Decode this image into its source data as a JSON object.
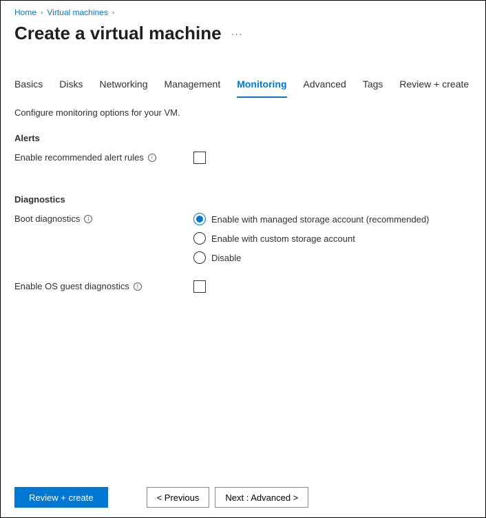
{
  "breadcrumb": {
    "items": [
      "Home",
      "Virtual machines"
    ]
  },
  "pageTitle": "Create a virtual machine",
  "tabs": [
    {
      "label": "Basics",
      "active": false
    },
    {
      "label": "Disks",
      "active": false
    },
    {
      "label": "Networking",
      "active": false
    },
    {
      "label": "Management",
      "active": false
    },
    {
      "label": "Monitoring",
      "active": true
    },
    {
      "label": "Advanced",
      "active": false
    },
    {
      "label": "Tags",
      "active": false
    },
    {
      "label": "Review + create",
      "active": false
    }
  ],
  "description": "Configure monitoring options for your VM.",
  "sections": {
    "alerts": {
      "heading": "Alerts",
      "field": {
        "label": "Enable recommended alert rules",
        "checked": false
      }
    },
    "diagnostics": {
      "heading": "Diagnostics",
      "bootDiagnostics": {
        "label": "Boot diagnostics",
        "options": [
          {
            "label": "Enable with managed storage account (recommended)",
            "selected": true
          },
          {
            "label": "Enable with custom storage account",
            "selected": false
          },
          {
            "label": "Disable",
            "selected": false
          }
        ]
      },
      "osGuest": {
        "label": "Enable OS guest diagnostics",
        "checked": false
      }
    }
  },
  "footer": {
    "reviewCreate": "Review + create",
    "previous": "< Previous",
    "next": "Next : Advanced >"
  }
}
